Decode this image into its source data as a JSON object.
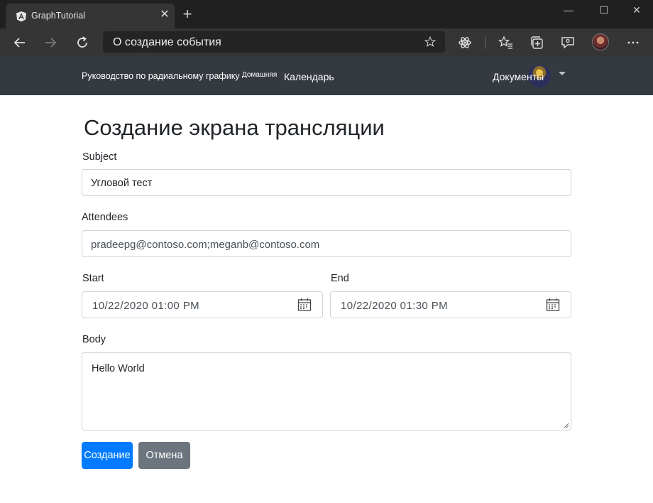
{
  "browser": {
    "tab_title": "GraphTutorial",
    "tab_close": "✕",
    "new_tab": "+",
    "address": "О создание события",
    "window_controls": {
      "minimize": "—",
      "maximize": "☐",
      "close": "✕"
    },
    "icons": [
      "back-icon",
      "forward-icon",
      "refresh-icon",
      "favorite-star-icon",
      "extension-icon",
      "favorites-icon",
      "collections-icon",
      "feedback-icon",
      "profile-avatar",
      "more-icon"
    ]
  },
  "navbar": {
    "brand": "Руководство по радиальному графику",
    "home": "Домашняя",
    "calendar": "Календарь",
    "docs": "Документы"
  },
  "form": {
    "title": "Создание экрана трансляции",
    "subject_label": "Subject",
    "subject_value": "Угловой тест",
    "attendees_label": "Attendees",
    "attendees_value": "pradeepg@contoso.com;meganb@contoso.com",
    "start_label": "Start",
    "start_value": "10/22/2020 01:00 PM",
    "end_label": "End",
    "end_value": "10/22/2020 01:30 PM",
    "body_label": "Body",
    "body_value": "Hello World",
    "create_button": "Создание",
    "cancel_button": "Отмена"
  },
  "colors": {
    "navbar_bg": "#343a40",
    "primary": "#007bff",
    "secondary": "#6c757d",
    "browser_dark": "#202020"
  }
}
